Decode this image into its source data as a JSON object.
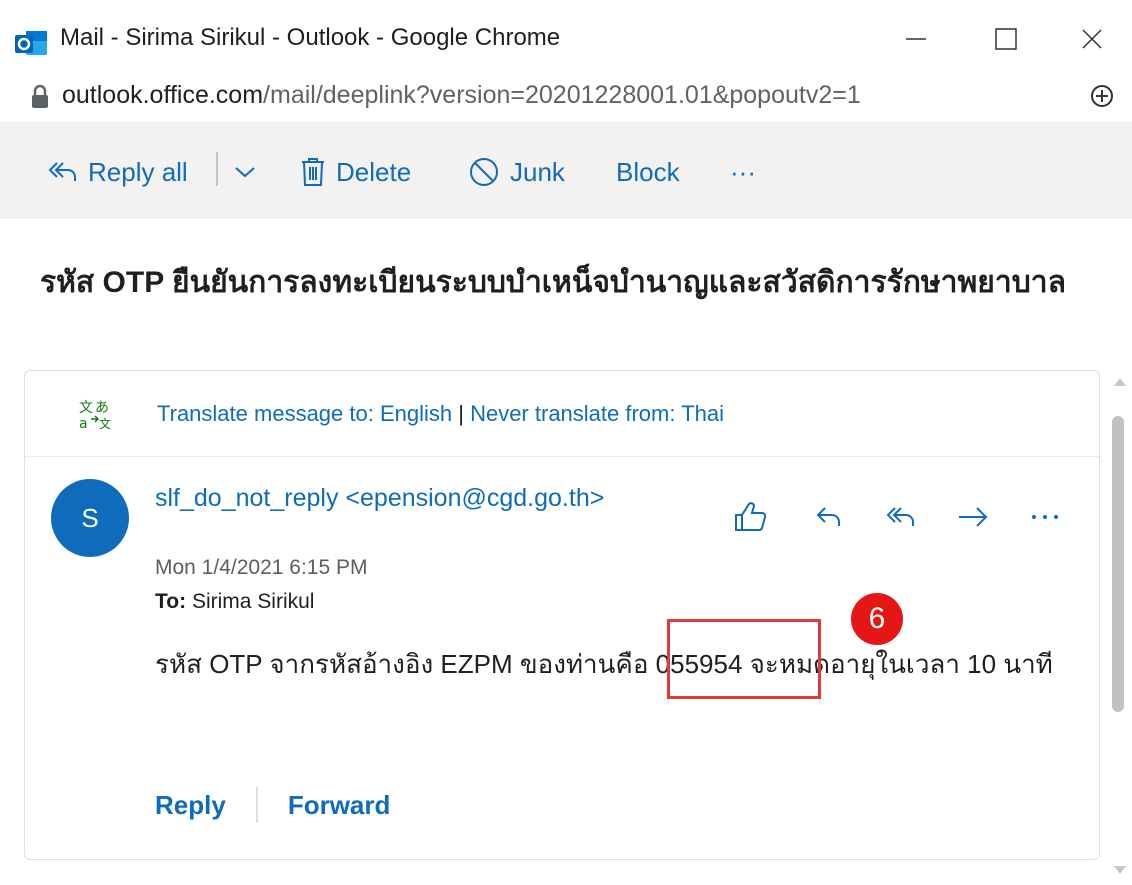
{
  "window": {
    "title": "Mail - Sirima Sirikul - Outlook - Google Chrome"
  },
  "address": {
    "host": "outlook.office.com",
    "path": "/mail/deeplink?version=20201228001.01&popoutv2=1"
  },
  "toolbar": {
    "reply_all": "Reply all",
    "delete": "Delete",
    "junk": "Junk",
    "block": "Block",
    "more": "···"
  },
  "email": {
    "subject": "รหัส OTP ยืนยันการลงทะเบียนระบบบำเหน็จบำนาญและสวัสดิการรักษาพยาบาล",
    "translate": {
      "translate_to": "Translate message to: English",
      "separator": "|",
      "never": "Never translate from: Thai"
    },
    "avatar_initial": "S",
    "sender": "slf_do_not_reply <epension@cgd.go.th>",
    "date": "Mon 1/4/2021 6:15 PM",
    "to_label": "To:",
    "to_value": "Sirima Sirikul",
    "body": "รหัส OTP จากรหัสอ้างอิง EZPM ของท่านคือ 055954 จะหมดอายุในเวลา 10 นาที",
    "reply": "Reply",
    "forward": "Forward"
  },
  "annotation": {
    "step_number": "6"
  },
  "colors": {
    "accent": "#0f6cbd",
    "annotation_red": "#e53935",
    "toolbar_bg": "#f3f2f1"
  }
}
